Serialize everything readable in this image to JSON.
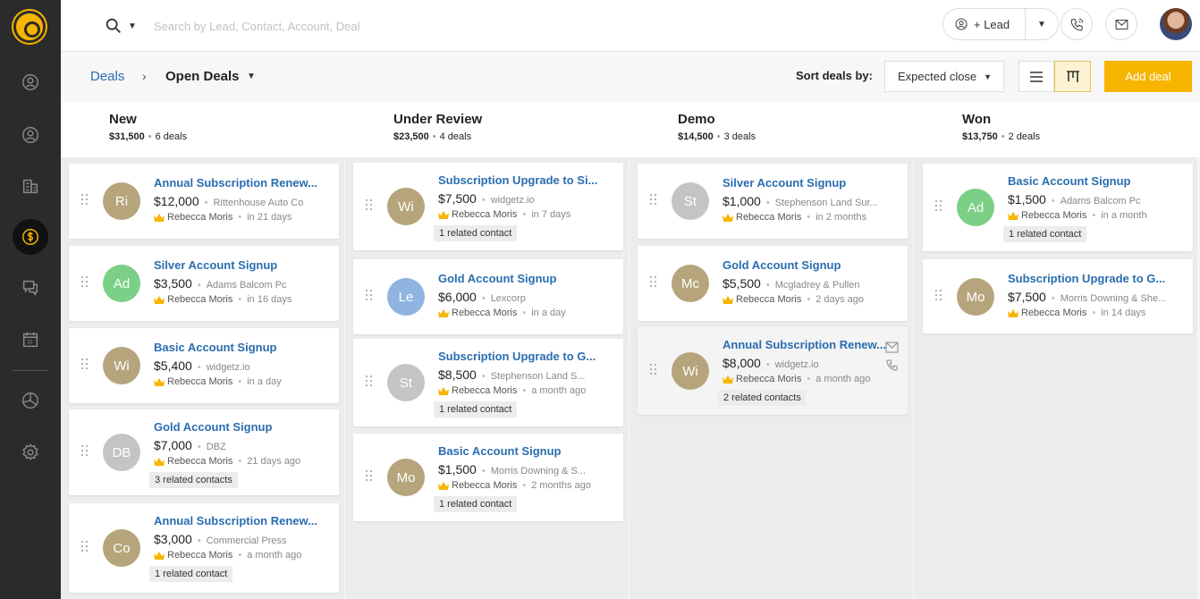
{
  "topbar": {
    "search_placeholder": "Search by Lead, Contact, Account, Deal",
    "lead_button": "+ Lead"
  },
  "breadcrumb": {
    "root": "Deals",
    "current": "Open Deals"
  },
  "sort": {
    "label": "Sort deals by:",
    "value": "Expected close"
  },
  "add_deal": "Add deal",
  "colors": {
    "accent": "#f7b500",
    "link": "#2a6db0"
  },
  "stages": [
    {
      "name": "New",
      "amount": "$31,500",
      "count": "6 deals",
      "cards": [
        {
          "initials": "Ri",
          "color": "#b6a57c",
          "title": "Annual Subscription Renew...",
          "amount": "$12,000",
          "company": "Rittenhouse Auto Co",
          "owner": "Rebecca Moris",
          "due": "in 21 days",
          "related": ""
        },
        {
          "initials": "Ad",
          "color": "#7bcf86",
          "title": "Silver Account Signup",
          "amount": "$3,500",
          "company": "Adams Balcom Pc",
          "owner": "Rebecca Moris",
          "due": "in 16 days",
          "related": ""
        },
        {
          "initials": "Wi",
          "color": "#b6a57c",
          "title": "Basic Account Signup",
          "amount": "$5,400",
          "company": "widgetz.io",
          "owner": "Rebecca Moris",
          "due": "in a day",
          "related": ""
        },
        {
          "initials": "DB",
          "color": "#c4c4c4",
          "title": "Gold Account Signup",
          "amount": "$7,000",
          "company": "DBZ",
          "owner": "Rebecca Moris",
          "due": "21 days ago",
          "related": "3 related contacts"
        },
        {
          "initials": "Co",
          "color": "#b6a57c",
          "title": "Annual Subscription Renew...",
          "amount": "$3,000",
          "company": "Commercial Press",
          "owner": "Rebecca Moris",
          "due": "a month ago",
          "related": "1 related contact"
        }
      ]
    },
    {
      "name": "Under Review",
      "amount": "$23,500",
      "count": "4 deals",
      "cards": [
        {
          "initials": "Wi",
          "color": "#b6a57c",
          "title": "Subscription Upgrade to Si...",
          "amount": "$7,500",
          "company": "widgetz.io",
          "owner": "Rebecca Moris",
          "due": "in 7 days",
          "related": "1 related contact"
        },
        {
          "initials": "Le",
          "color": "#8fb4e0",
          "title": "Gold Account Signup",
          "amount": "$6,000",
          "company": "Lexcorp",
          "owner": "Rebecca Moris",
          "due": "in a day",
          "related": ""
        },
        {
          "initials": "St",
          "color": "#c4c4c4",
          "title": "Subscription Upgrade to G...",
          "amount": "$8,500",
          "company": "Stephenson Land S...",
          "owner": "Rebecca Moris",
          "due": "a month ago",
          "related": "1 related contact"
        },
        {
          "initials": "Mo",
          "color": "#b6a57c",
          "title": "Basic Account Signup",
          "amount": "$1,500",
          "company": "Morris Downing & S...",
          "owner": "Rebecca Moris",
          "due": "2 months ago",
          "related": "1 related contact"
        }
      ]
    },
    {
      "name": "Demo",
      "amount": "$14,500",
      "count": "3 deals",
      "cards": [
        {
          "initials": "St",
          "color": "#c4c4c4",
          "title": "Silver Account Signup",
          "amount": "$1,000",
          "company": "Stephenson Land Sur...",
          "owner": "Rebecca Moris",
          "due": "in 2 months",
          "related": ""
        },
        {
          "initials": "Mc",
          "color": "#b6a57c",
          "title": "Gold Account Signup",
          "amount": "$5,500",
          "company": "Mcgladrey & Pullen",
          "owner": "Rebecca Moris",
          "due": "2 days ago",
          "related": ""
        },
        {
          "initials": "Wi",
          "color": "#b6a57c",
          "title": "Annual Subscription Renew...",
          "amount": "$8,000",
          "company": "widgetz.io",
          "owner": "Rebecca Moris",
          "due": "a month ago",
          "related": "2 related contacts"
        }
      ]
    },
    {
      "name": "Won",
      "amount": "$13,750",
      "count": "2 deals",
      "cards": [
        {
          "initials": "Ad",
          "color": "#7bcf86",
          "title": "Basic Account Signup",
          "amount": "$1,500",
          "company": "Adams Balcom Pc",
          "owner": "Rebecca Moris",
          "due": "in a month",
          "related": "1 related contact"
        },
        {
          "initials": "Mo",
          "color": "#b6a57c",
          "title": "Subscription Upgrade to G...",
          "amount": "$7,500",
          "company": "Morris Downing & She...",
          "owner": "Rebecca Moris",
          "due": "in 14 days",
          "related": ""
        }
      ]
    }
  ]
}
